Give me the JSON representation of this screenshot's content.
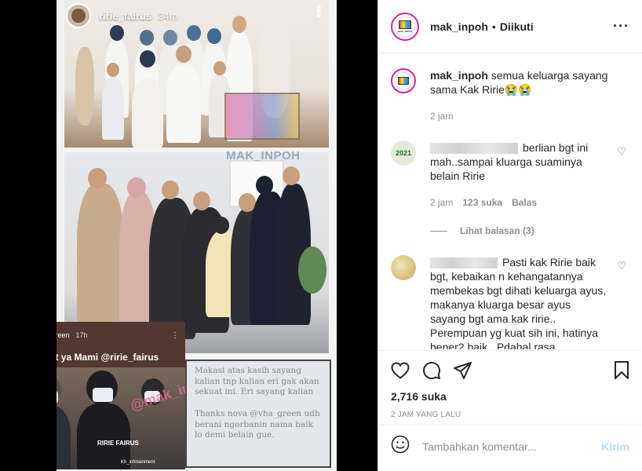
{
  "story": {
    "username": "ririe_fairus",
    "time": "34m",
    "watermark": "MAK_INPOH",
    "repost": {
      "username": "vha_green",
      "time": "17h",
      "title": "Kuat ya Mami @ririe_fairus",
      "caption": "RIRIE FAIRUS",
      "logo": "Kh",
      "credit": "Kh_infotainment",
      "watermark": "@mak_inpoh"
    },
    "note": {
      "paragraph1": "Makasi atas kasih sayang kalian tnp kalian eri gak akan sekuat ini. Eri sayang kalian",
      "paragraph2": "Thanks nova @vha_green udh berani ngorbanin nama baik lo demi belain gue."
    }
  },
  "post": {
    "author": "mak_inpoh",
    "follow_status": "Diikuti",
    "brand_label": "MAK_INPOH",
    "caption_user": "mak_inpoh",
    "caption_text": "semua keluarga sayang sama Kak Ririe😭😭",
    "caption_time": "2 jam",
    "likes": "2,716 suka",
    "posted_ago": "2 JAM YANG LALU",
    "comment_placeholder": "Tambahkan komentar...",
    "send_label": "Kirim"
  },
  "comments": [
    {
      "text": "berlian bgt ini mah..sampai kluarga suaminya belain Ririe",
      "time": "2 jam",
      "likes": "123 suka",
      "reply": "Balas",
      "view_replies": "Lihat balasan (3)",
      "avatar_label": "2021"
    },
    {
      "text": "Pasti kak Ririe baik bgt, kebaikan n kehangatannya membekas bgt dihati keluarga ayus, makanya kluarga besar ayus sayang bgt ama kak ririe.. Perempuan yg kuat sih ini, hatinya bener2 baik.. Pdahal rasa"
    }
  ],
  "colors": {
    "accent": "#0095f6",
    "send_disabled": "#b2dffc",
    "muted": "#8e8e8e",
    "text": "#262626"
  }
}
